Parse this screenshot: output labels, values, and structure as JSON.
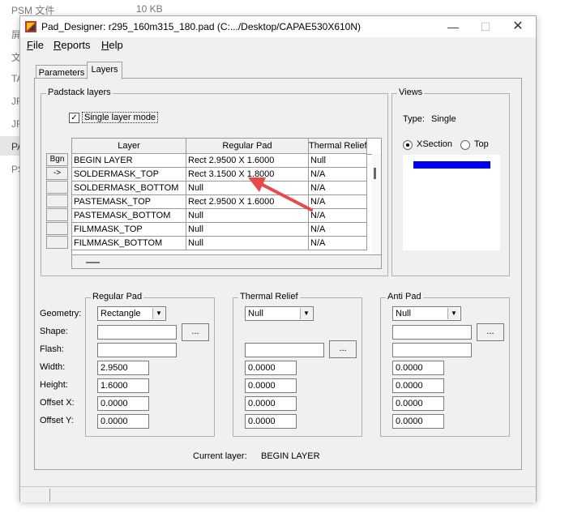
{
  "background": {
    "file_name": "PSM 文件",
    "file_size": "10 KB",
    "side_chars": [
      "屏",
      "文",
      "TA",
      "JF",
      "JF",
      "PA",
      "PS"
    ]
  },
  "window": {
    "title": "Pad_Designer: r295_160m315_180.pad (C:.../Desktop/CAPAE530X610N)",
    "controls": {
      "minimize": "—",
      "maximize": "☐",
      "close": "✕"
    }
  },
  "menu": [
    {
      "underlined": "F",
      "rest": "ile"
    },
    {
      "underlined": "R",
      "rest": "eports"
    },
    {
      "underlined": "H",
      "rest": "elp"
    }
  ],
  "tabs": {
    "parameters": "Parameters",
    "layers": "Layers"
  },
  "padstack_layers": {
    "group_label": "Padstack layers",
    "single_layer_mode": {
      "label": "Single layer mode",
      "checked": true,
      "mark": "✓"
    },
    "columns": [
      "Layer",
      "Regular Pad",
      "Thermal Relief"
    ],
    "row_buttons": [
      "Bgn",
      "->",
      "",
      "",
      "",
      "",
      ""
    ],
    "rows": [
      {
        "layer": "BEGIN LAYER",
        "regular_pad": "Rect 2.9500 X 1.6000",
        "thermal_relief": "Null"
      },
      {
        "layer": "SOLDERMASK_TOP",
        "regular_pad": "Rect 3.1500 X 1.8000",
        "thermal_relief": "N/A"
      },
      {
        "layer": "SOLDERMASK_BOTTOM",
        "regular_pad": "Null",
        "thermal_relief": "N/A"
      },
      {
        "layer": "PASTEMASK_TOP",
        "regular_pad": "Rect 2.9500 X 1.6000",
        "thermal_relief": "N/A"
      },
      {
        "layer": "PASTEMASK_BOTTOM",
        "regular_pad": "Null",
        "thermal_relief": "N/A"
      },
      {
        "layer": "FILMMASK_TOP",
        "regular_pad": "Null",
        "thermal_relief": "N/A"
      },
      {
        "layer": "FILMMASK_BOTTOM",
        "regular_pad": "Null",
        "thermal_relief": "N/A"
      }
    ]
  },
  "views": {
    "group_label": "Views",
    "type_label": "Type:",
    "type_value": "Single",
    "xsection_label": "XSection",
    "top_label": "Top",
    "selected": "XSection",
    "bar_color": "#0000ee"
  },
  "field_labels": [
    "Geometry:",
    "Shape:",
    "Flash:",
    "Width:",
    "Height:",
    "Offset X:",
    "Offset Y:"
  ],
  "regular_pad": {
    "label": "Regular Pad",
    "geometry": "Rectangle",
    "shape": "",
    "flash": "",
    "width": "2.9500",
    "height": "1.6000",
    "offset_x": "0.0000",
    "offset_y": "0.0000",
    "browse": "..."
  },
  "thermal_relief": {
    "label": "Thermal Relief",
    "geometry": "Null",
    "shape": "",
    "flash": "",
    "width": "0.0000",
    "height": "0.0000",
    "offset_x": "0.0000",
    "offset_y": "0.0000",
    "browse": "..."
  },
  "anti_pad": {
    "label": "Anti Pad",
    "geometry": "Null",
    "shape": "",
    "flash": "",
    "width": "0.0000",
    "height": "0.0000",
    "offset_x": "0.0000",
    "offset_y": "0.0000",
    "browse": "..."
  },
  "current_layer": {
    "label": "Current layer:",
    "value": "BEGIN LAYER"
  },
  "annotation_color": "#e84a4a"
}
